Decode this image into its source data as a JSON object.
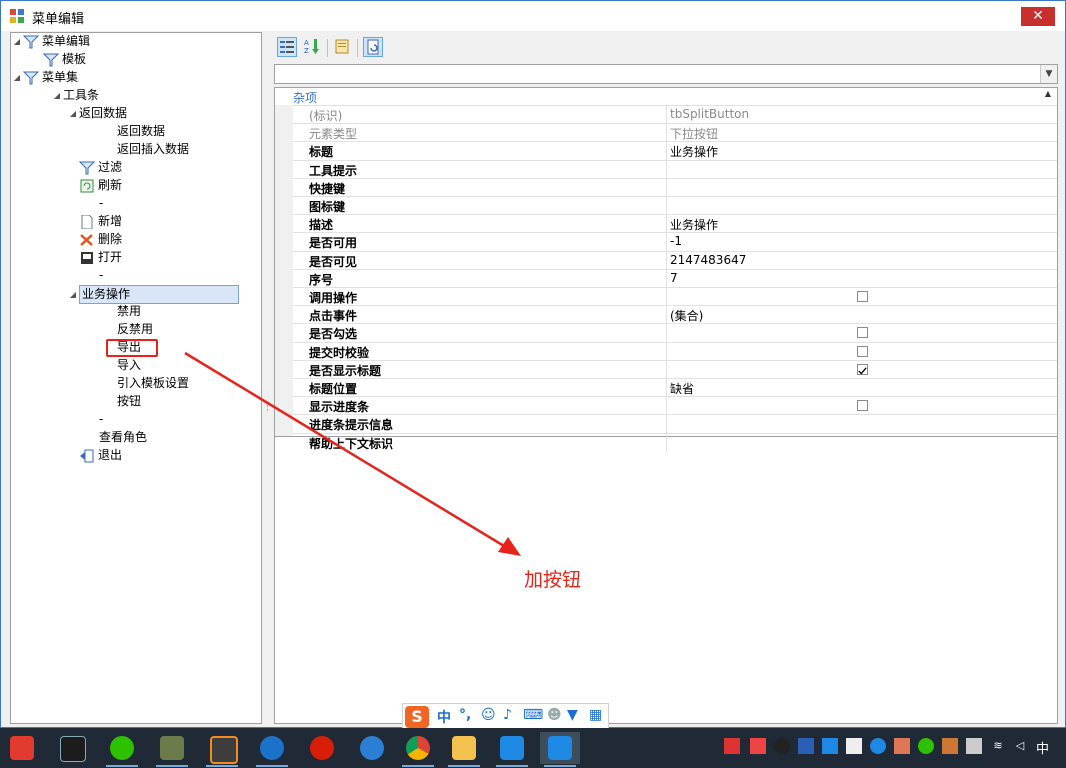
{
  "window": {
    "title": "菜单编辑",
    "close_label": "✕"
  },
  "tree": {
    "items": [
      {
        "label": "菜单编辑",
        "expander": "◢",
        "icon": "filter-icon"
      },
      {
        "label": "模板",
        "expander": "",
        "icon": "filter-icon"
      },
      {
        "label": "菜单集",
        "expander": "◢",
        "icon": "filter-icon"
      },
      {
        "label": "工具条",
        "expander": "◢",
        "icon": ""
      },
      {
        "label": "返回数据",
        "expander": "◢",
        "icon": ""
      },
      {
        "label": "返回数据",
        "expander": "",
        "icon": ""
      },
      {
        "label": "返回插入数据",
        "expander": "",
        "icon": ""
      },
      {
        "label": "过滤",
        "expander": "",
        "icon": "filter-icon"
      },
      {
        "label": "刷新",
        "expander": "",
        "icon": "refresh-icon"
      },
      {
        "label": "-",
        "expander": "",
        "icon": ""
      },
      {
        "label": "新增",
        "expander": "",
        "icon": "new-doc-icon"
      },
      {
        "label": "删除",
        "expander": "",
        "icon": "delete-icon"
      },
      {
        "label": "打开",
        "expander": "",
        "icon": "open-icon"
      },
      {
        "label": "-",
        "expander": "",
        "icon": ""
      },
      {
        "label": "业务操作",
        "expander": "◢",
        "icon": ""
      },
      {
        "label": "禁用",
        "expander": "",
        "icon": ""
      },
      {
        "label": "反禁用",
        "expander": "",
        "icon": ""
      },
      {
        "label": "导出",
        "expander": "",
        "icon": ""
      },
      {
        "label": "导入",
        "expander": "",
        "icon": ""
      },
      {
        "label": "引入模板设置",
        "expander": "",
        "icon": ""
      },
      {
        "label": "按钮",
        "expander": "",
        "icon": ""
      },
      {
        "label": "-",
        "expander": "",
        "icon": ""
      },
      {
        "label": "查看角色",
        "expander": "",
        "icon": ""
      },
      {
        "label": "退出",
        "expander": "",
        "icon": "exit-icon"
      }
    ]
  },
  "propgrid": {
    "combo_value": "",
    "category": "杂项",
    "rows": [
      {
        "name": "(标识)",
        "value": "tbSplitButton",
        "dim": true
      },
      {
        "name": "元素类型",
        "value": "下拉按钮",
        "dim": true
      },
      {
        "name": "标题",
        "value": "业务操作"
      },
      {
        "name": "工具提示",
        "value": ""
      },
      {
        "name": "快捷键",
        "value": ""
      },
      {
        "name": "图标键",
        "value": ""
      },
      {
        "name": "描述",
        "value": "业务操作"
      },
      {
        "name": "是否可用",
        "value": "-1"
      },
      {
        "name": "是否可见",
        "value": "2147483647"
      },
      {
        "name": "序号",
        "value": "7"
      },
      {
        "name": "调用操作",
        "value": "",
        "checkbox": "unchecked"
      },
      {
        "name": "点击事件",
        "value": "(集合)"
      },
      {
        "name": "是否勾选",
        "value": "",
        "checkbox": "unchecked"
      },
      {
        "name": "提交时校验",
        "value": "",
        "checkbox": "unchecked"
      },
      {
        "name": "是否显示标题",
        "value": "",
        "checkbox": "checked"
      },
      {
        "name": "标题位置",
        "value": "缺省"
      },
      {
        "name": "显示进度条",
        "value": "",
        "checkbox": "unchecked"
      },
      {
        "name": "进度条提示信息",
        "value": ""
      },
      {
        "name": "帮助上下文标识",
        "value": ""
      }
    ]
  },
  "annotation": {
    "text": "加按钮",
    "color": "#e8231a"
  },
  "ime": {
    "logo": "S",
    "lang": "中",
    "punct": "°,"
  },
  "taskbar": {
    "clock": "中",
    "input_indicator": "中"
  }
}
